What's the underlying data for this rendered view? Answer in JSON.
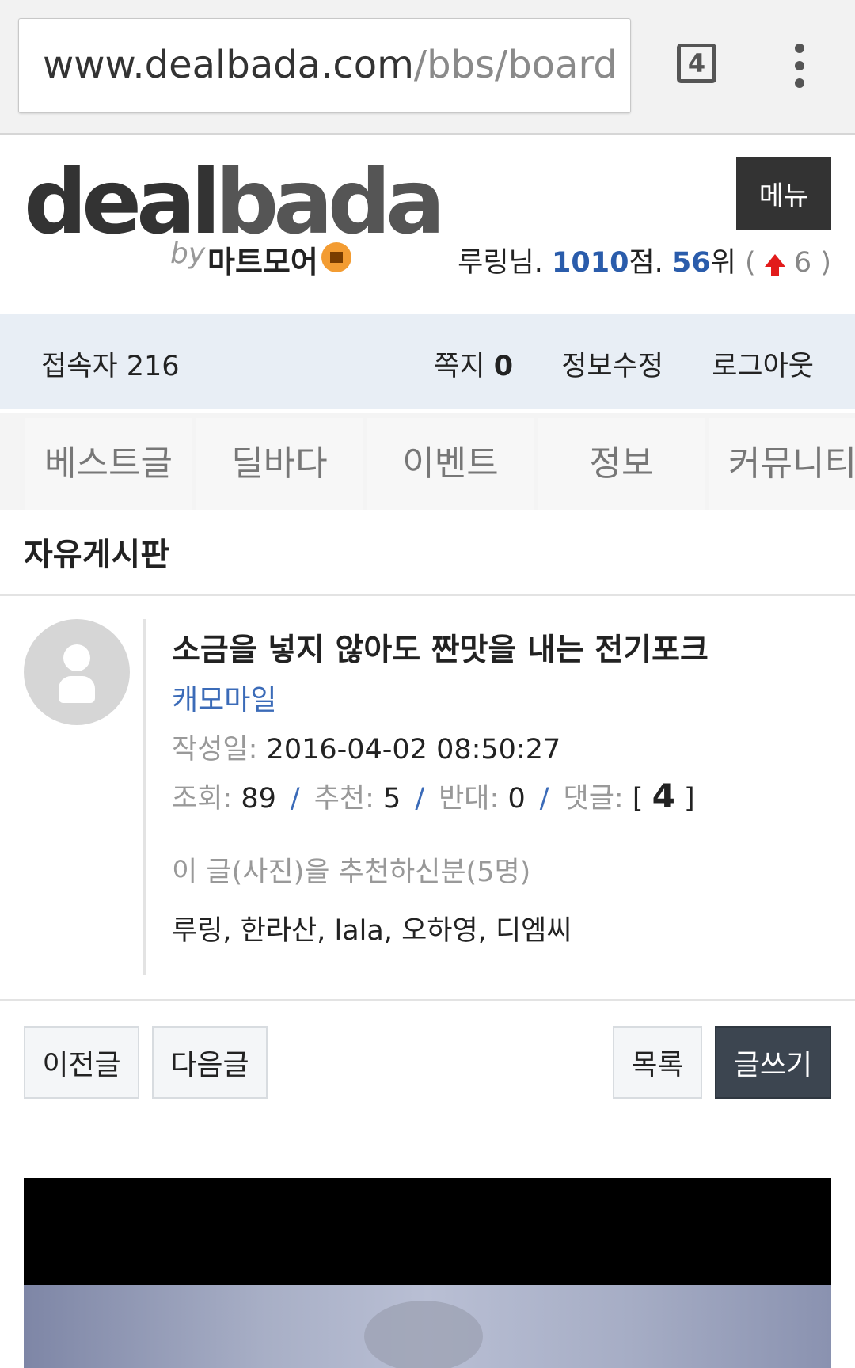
{
  "browser": {
    "url_host": "www.dealbada.com",
    "url_path": "/bbs/board",
    "tab_count": "4"
  },
  "header": {
    "logo_word_a": "deal",
    "logo_word_b": "bada",
    "logo_by": "by",
    "logo_sub": "마트모어",
    "menu_label": "메뉴",
    "user_name": "루링님.",
    "points": "1010",
    "points_suffix": "점.",
    "rank": "56",
    "rank_suffix": "위",
    "rank_change": "6",
    "paren_open": "(",
    "paren_close": ")"
  },
  "infobar": {
    "visitors_label": "접속자 216",
    "messages_label": "쪽지",
    "messages_count": "0",
    "edit_info": "정보수정",
    "logout": "로그아웃"
  },
  "nav": {
    "items": [
      {
        "label": "베스트글"
      },
      {
        "label": "딜바다"
      },
      {
        "label": "이벤트"
      },
      {
        "label": "정보"
      },
      {
        "label": "커뮤니티"
      }
    ]
  },
  "board": {
    "title": "자유게시판"
  },
  "post": {
    "title": "소금을 넣지 않아도 짠맛을 내는 전기포크",
    "author": "캐모마일",
    "date_label": "작성일:",
    "date": "2016-04-02 08:50:27",
    "views_label": "조회:",
    "views": "89",
    "recommend_label": "추천:",
    "recommend": "5",
    "oppose_label": "반대:",
    "oppose": "0",
    "comments_label": "댓글:",
    "comments": "4",
    "bracket_open": "[",
    "bracket_close": "]",
    "sep": "/",
    "recommenders_label": "이 글(사진)을 추천하신분(5명)",
    "recommenders": "루링, 한라산, lala, 오하영, 디엠씨"
  },
  "actions": {
    "prev": "이전글",
    "next": "다음글",
    "list": "목록",
    "write": "글쓰기"
  },
  "colors": {
    "accent_blue": "#2a5cab",
    "dark_button": "#3c4550",
    "info_bar": "#e8eef5",
    "rank_up": "#e21b1b"
  }
}
